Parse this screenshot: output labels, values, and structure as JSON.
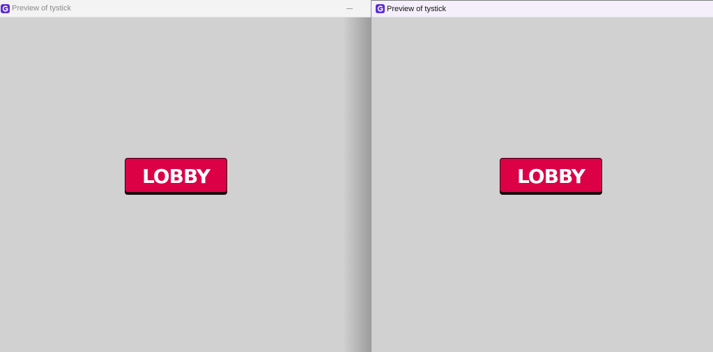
{
  "windows": [
    {
      "title": "Preview of tystick",
      "app_icon": "tystick-app-icon",
      "controls": {
        "minimize_icon": "minimize-icon"
      },
      "content": {
        "button_label": "LOBBY"
      }
    },
    {
      "title": "Preview of tystick",
      "app_icon": "tystick-app-icon",
      "content": {
        "button_label": "LOBBY"
      }
    }
  ],
  "colors": {
    "background": "#d1d1d1",
    "button": "#dc0046",
    "button_text": "#ffffff",
    "button_shadow": "#0c0c0c",
    "app_icon": "#5b2bd6"
  }
}
